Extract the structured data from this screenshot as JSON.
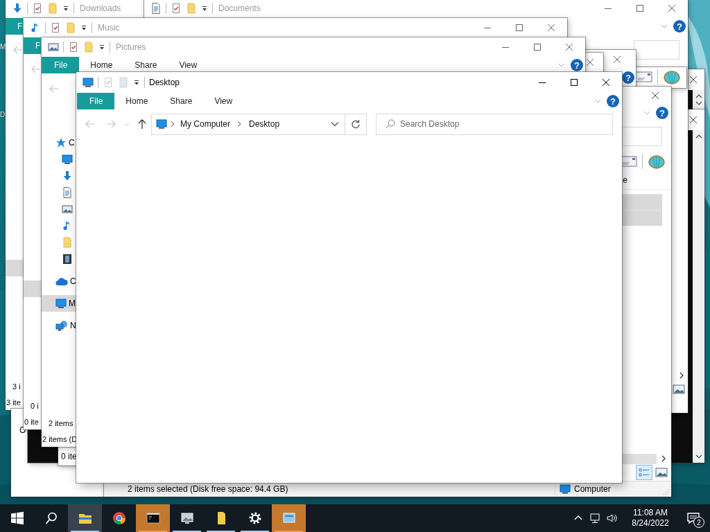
{
  "desktop_labels": [
    "M",
    "D"
  ],
  "windows": [
    {
      "kind": "console"
    },
    {
      "kind": "console"
    },
    {
      "kind": "explorer",
      "title": "Downloads",
      "tabs": [
        {
          "label": "F",
          "kind": "menu"
        }
      ],
      "nav": [
        {
          "selected": true
        }
      ],
      "footer": [
        "3 i",
        "3 ite"
      ]
    },
    {
      "kind": "explorer",
      "title": "Documents",
      "help": "?"
    },
    {
      "kind": "legacy"
    },
    {
      "kind": "explorer",
      "help": "?"
    },
    {
      "kind": "explorer"
    },
    {
      "kind": "blank",
      "texts": [
        "O"
      ]
    },
    {
      "kind": "console"
    },
    {
      "kind": "explorer",
      "title": "Music",
      "tabs": [
        {
          "label": "F",
          "kind": "menu"
        }
      ],
      "nav": [
        {
          "selected": true
        }
      ],
      "footer": [
        "0 i",
        "0 ite"
      ]
    },
    {
      "kind": "explorer",
      "title": "Pictures",
      "tabs": [
        {
          "label": "File",
          "kind": "menu"
        },
        {
          "label": "Home",
          "kind": "tab"
        },
        {
          "label": "Share",
          "kind": "tab"
        },
        {
          "label": "View",
          "kind": "tab"
        }
      ],
      "help": "?",
      "nav": [
        {
          "kind": "star",
          "label": "C",
          "selected": false,
          "children": [
            {
              "kind": "monitor",
              "selected": false
            },
            {
              "kind": "download",
              "selected": false
            },
            {
              "kind": "document",
              "selected": false
            },
            {
              "kind": "picture",
              "selected": false
            },
            {
              "kind": "note",
              "selected": false
            },
            {
              "kind": "folder",
              "selected": false
            },
            {
              "kind": "film",
              "selected": false
            }
          ]
        },
        {
          "kind": "cloud",
          "label": "C",
          "selected": false
        },
        {
          "kind": "monitor",
          "label": "M",
          "selected": true
        },
        {
          "kind": "network",
          "label": "N",
          "selected": false
        }
      ],
      "footer": [
        "2 items",
        "2 items (D"
      ]
    },
    {
      "kind": "legacy",
      "help": "?",
      "columns": [
        "e"
      ],
      "rows": [
        {
          "selected": true
        },
        {
          "selected": true
        }
      ],
      "views": [
        {
          "kind": "details",
          "selected": true
        },
        {
          "kind": "preview",
          "selected": false
        }
      ],
      "status": "2 items selected (Disk free space: 94.4 GB)",
      "location": "Computer"
    },
    {
      "kind": "blank",
      "texts": [
        "0 ite"
      ]
    }
  ],
  "front_window": {
    "title": "Desktop",
    "tabs": [
      {
        "label": "File",
        "kind": "menu"
      },
      {
        "label": "Home",
        "kind": "tab"
      },
      {
        "label": "Share",
        "kind": "tab"
      },
      {
        "label": "View",
        "kind": "tab"
      }
    ],
    "help": "?",
    "path": [
      "My Computer",
      "Desktop"
    ],
    "search_placeholder": "Search Desktop"
  },
  "taskbar": {
    "items": [
      {
        "kind": "start",
        "running": false,
        "active": false,
        "flashing": false
      },
      {
        "kind": "search",
        "running": false,
        "active": false,
        "flashing": false
      },
      {
        "kind": "explorer",
        "running": true,
        "active": true,
        "flashing": false
      },
      {
        "kind": "browser",
        "running": false,
        "active": false,
        "flashing": false
      },
      {
        "kind": "terminal",
        "running": true,
        "active": false,
        "flashing": true
      },
      {
        "kind": "imageapp",
        "running": true,
        "active": false,
        "flashing": false
      },
      {
        "kind": "note",
        "running": true,
        "active": false,
        "flashing": false
      },
      {
        "kind": "gear",
        "running": true,
        "active": false,
        "flashing": false
      },
      {
        "kind": "window",
        "running": true,
        "active": false,
        "flashing": true
      }
    ],
    "time": "11:08 AM",
    "date": "8/24/2022",
    "notifications": "2"
  }
}
